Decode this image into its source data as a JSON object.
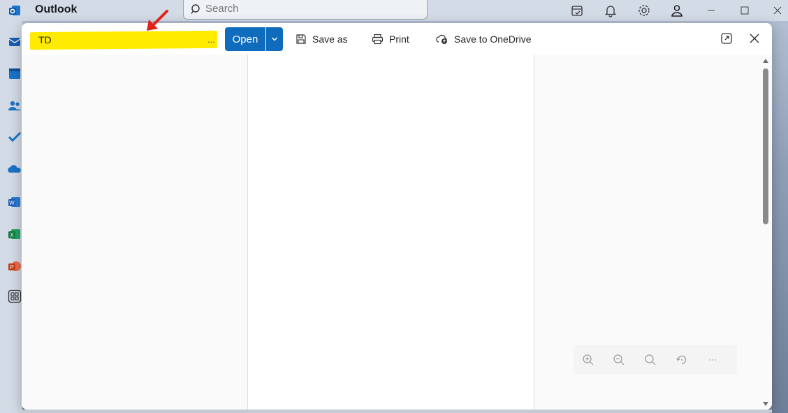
{
  "app": {
    "title": "Outlook"
  },
  "search": {
    "placeholder": "Search"
  },
  "titlebar_icons": [
    "my-day-icon",
    "bell-icon",
    "gear-icon",
    "account-icon"
  ],
  "window_controls": [
    "minimize-icon",
    "maximize-icon",
    "close-icon"
  ],
  "rail_icons": [
    "mail-icon",
    "calendar-icon",
    "people-icon",
    "todo-icon",
    "onedrive-icon",
    "word-icon",
    "excel-icon",
    "powerpoint-icon",
    "more-apps-icon"
  ],
  "attachment": {
    "file_name": "TD",
    "ellipsis": "..."
  },
  "toolbar": {
    "open_label": "Open",
    "save_as_label": "Save as",
    "print_label": "Print",
    "save_onedrive_label": "Save to OneDrive"
  },
  "zoom_controls": [
    "zoom-in-icon",
    "zoom-out-icon",
    "fit-icon",
    "rotate-icon",
    "more-icon"
  ],
  "colors": {
    "accent": "#0f6cbd",
    "highlight": "#ffeb00",
    "arrow": "#e0231b"
  }
}
